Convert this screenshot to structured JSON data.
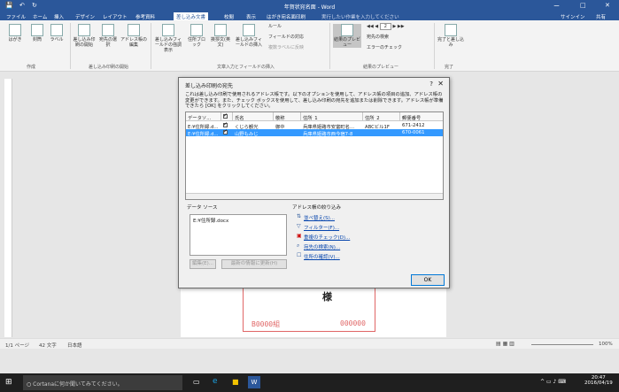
{
  "window": {
    "title": "年賀状宛名面 - Word",
    "controls": [
      "ー",
      "□",
      "✕"
    ]
  },
  "tabs": [
    {
      "label": "ファイル"
    },
    {
      "label": "ホーム"
    },
    {
      "label": "挿入"
    },
    {
      "label": "デザイン"
    },
    {
      "label": "レイアウト"
    },
    {
      "label": "参考資料"
    },
    {
      "label": "差し込み文書"
    },
    {
      "label": "校閲"
    },
    {
      "label": "表示"
    },
    {
      "label": "はがき宛名面印刷"
    }
  ],
  "tell_me": "実行したい作業を入力してください",
  "signin": "サインイン",
  "share": "共有",
  "ribbon": {
    "buttons": [
      {
        "label": "はがき"
      },
      {
        "label": "封筒"
      },
      {
        "label": "ラベル"
      },
      {
        "label": "差し込み印刷の開始"
      },
      {
        "label": "宛先の選択"
      },
      {
        "label": "アドレス帳の編集"
      },
      {
        "label": "差し込みフィールドの強調表示"
      },
      {
        "label": "住所ブロック"
      },
      {
        "label": "挨拶文(英文)"
      },
      {
        "label": "差し込みフィールドの挿入"
      },
      {
        "label": "結果のプレビュー"
      },
      {
        "label": "完了と差し込み"
      }
    ],
    "small": [
      "ルール",
      "フィールドの対応",
      "複数ラベルに反映",
      "宛先の検索",
      "エラーのチェック"
    ],
    "record": "2",
    "groups": [
      "作成",
      "差し込み印刷の開始",
      "文章入力とフィールドの挿入",
      "結果のプレビュー",
      "完了"
    ]
  },
  "dialog": {
    "title": "差し込み印刷の宛先",
    "help": "?",
    "close": "✕",
    "intro": "これは差し込み印刷で使用されるアドレス帳です。以下のオプションを使用して、アドレス帳の項目の追加、アドレス帳の変更ができます。また、チェック ボックスを使用して、差し込み印刷の宛先を追加または削除できます。アドレス帳が準備できたら [OK] をクリックしてください。",
    "columns": [
      "データソ...",
      "",
      "氏名",
      "敬称",
      "住所_1",
      "住所_2",
      "郵便番号"
    ],
    "rows": [
      {
        "source": "E:¥住所録.d...",
        "checked": true,
        "name": "くじら観光",
        "honorific": "御中",
        "addr1": "兵庫県姫路市安富町名...",
        "addr2": "ABCビル1F",
        "zip": "671-2412"
      },
      {
        "source": "E:¥住所録.d...",
        "checked": true,
        "name": "山野もみじ",
        "honorific": "",
        "addr1": "兵庫県姫路市西今宿7-8",
        "addr2": "",
        "zip": "670-0061"
      }
    ],
    "datasource_label": "データ ソース",
    "datasource_item": "E:¥住所録.docx",
    "edit_button": "編集(E)...",
    "refresh_button": "最新の情報に更新(H)",
    "refine_label": "アドレス帳の絞り込み",
    "refine_links": [
      {
        "label": "並べ替え(S)...",
        "icon": "sort-icon"
      },
      {
        "label": "フィルター(F)...",
        "icon": "filter-icon"
      },
      {
        "label": "重複のチェック(D)...",
        "icon": "duplicate-icon"
      },
      {
        "label": "宛先の検索(N)...",
        "icon": "find-icon"
      },
      {
        "label": "住所の確認(V)...",
        "icon": "validate-icon"
      }
    ],
    "ok": "OK"
  },
  "postcard": {
    "honorific_char": "様",
    "code1": "B0000組",
    "code2": "000000"
  },
  "status": {
    "page": "1/1 ページ",
    "words": "42 文字",
    "lang": "日本語",
    "zoom": "100%"
  },
  "taskbar": {
    "cortana": "Cortanaに何か聞いてみてください。",
    "time": "20:47",
    "date": "2016/04/19"
  },
  "colors": {
    "accent": "#2b579a",
    "selection": "#3399ff"
  }
}
